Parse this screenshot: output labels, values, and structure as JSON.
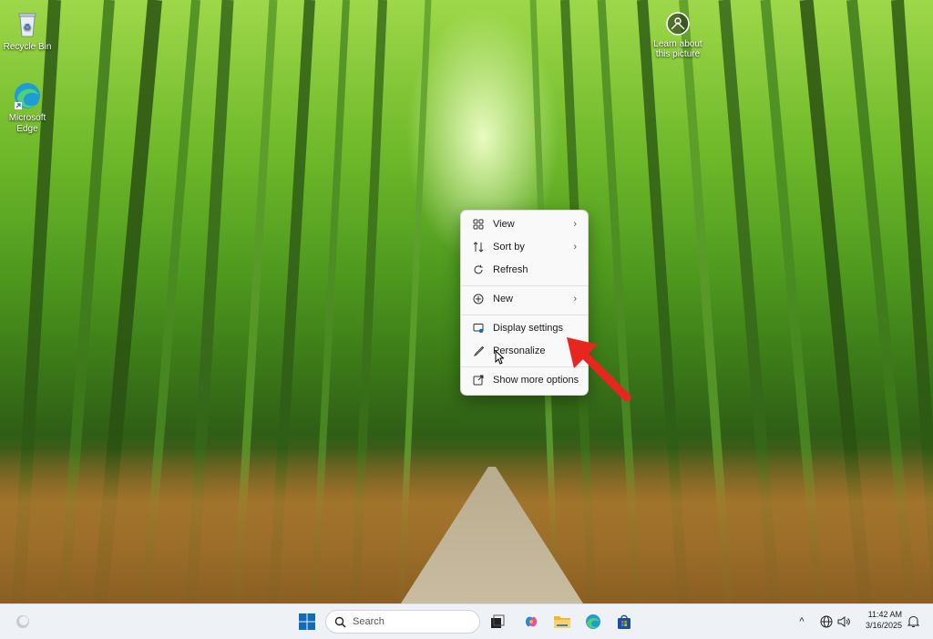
{
  "desktop": {
    "icons": [
      {
        "label": "Recycle Bin",
        "icon": "recycle-bin-icon"
      },
      {
        "label": "Microsoft Edge",
        "icon": "edge-icon"
      }
    ],
    "learn_about": "Learn about this picture"
  },
  "context_menu": {
    "items": [
      {
        "label": "View",
        "icon": "view-grid-icon",
        "submenu": true
      },
      {
        "label": "Sort by",
        "icon": "sort-icon",
        "submenu": true
      },
      {
        "label": "Refresh",
        "icon": "refresh-icon",
        "submenu": false
      },
      {
        "label": "New",
        "icon": "new-plus-icon",
        "submenu": true
      },
      {
        "label": "Display settings",
        "icon": "display-settings-icon",
        "submenu": false
      },
      {
        "label": "Personalize",
        "icon": "personalize-brush-icon",
        "submenu": false
      },
      {
        "label": "Show more options",
        "icon": "show-more-options-icon",
        "submenu": false
      }
    ],
    "chevron": "›"
  },
  "taskbar": {
    "search_placeholder": "Search",
    "time": "11:42 AM",
    "date": "3/16/2025",
    "chevron_up": "^"
  },
  "colors": {
    "arrow": "#e8261f",
    "win_blue": "#0f6cbd",
    "taskbar_bg": "#eef1f5"
  }
}
